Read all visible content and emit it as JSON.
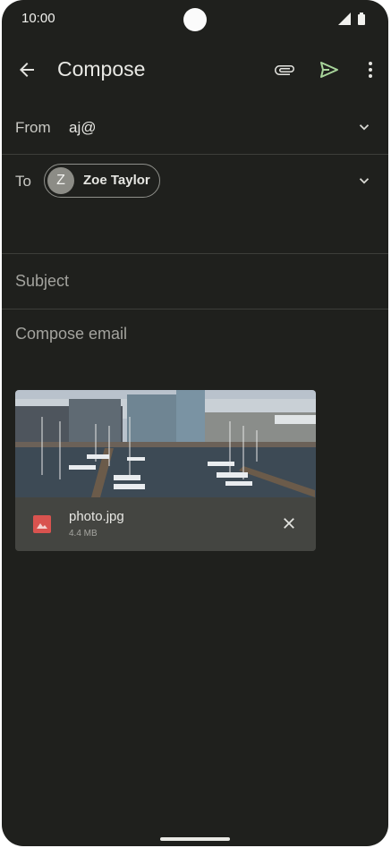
{
  "status": {
    "time": "10:00"
  },
  "appbar": {
    "title": "Compose"
  },
  "from": {
    "label": "From",
    "value": "aj@"
  },
  "to": {
    "label": "To",
    "recipient_initial": "Z",
    "recipient_name": "Zoe Taylor"
  },
  "subject": {
    "placeholder": "Subject"
  },
  "body": {
    "placeholder": "Compose email"
  },
  "attachment": {
    "file_name": "photo.jpg",
    "file_size": "4.4 MB"
  },
  "icons": [
    "back-arrow-icon",
    "paperclip-icon",
    "send-icon",
    "more-vert-icon",
    "chevron-down-icon",
    "image-file-icon",
    "close-icon",
    "signal-icon",
    "battery-icon"
  ],
  "colors": {
    "background": "#1f201d",
    "send_accent": "#a8d59b",
    "image_icon": "#d9534f"
  }
}
